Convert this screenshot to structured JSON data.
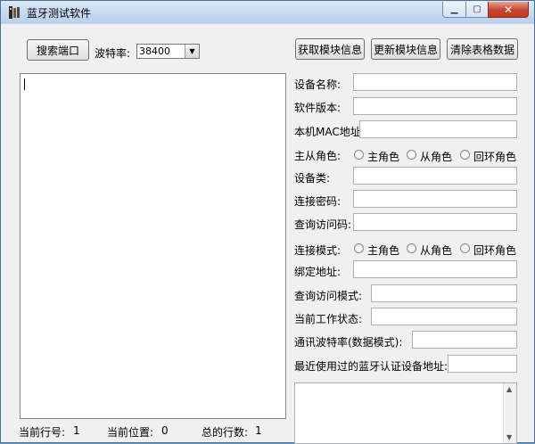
{
  "window": {
    "title": "蓝牙测试软件"
  },
  "toolbar": {
    "search_port": "搜索端口",
    "baud_label": "波特率:",
    "baud_value": "38400",
    "get_info": "获取模块信息",
    "update_info": "更新模块信息",
    "clear_table": "清除表格数据"
  },
  "form": {
    "device_name": "设备名称:",
    "software_version": "软件版本:",
    "local_mac": "本机MAC地址:",
    "role": "主从角色:",
    "device_class": "设备类:",
    "pin": "连接密码:",
    "inquiry_code": "查询访问码:",
    "conn_mode": "连接模式:",
    "bind_addr": "绑定地址:",
    "inquiry_mode": "查询访问模式:",
    "work_state": "当前工作状态:",
    "baud_data_mode": "通讯波特率(数据模式):",
    "recent_device": "最近使用过的蓝牙认证设备地址:",
    "radio_master": "主角色",
    "radio_slave": "从角色",
    "radio_loopback": "回环角色"
  },
  "status": {
    "line_label": "当前行号:",
    "line_value": "1",
    "pos_label": "当前位置:",
    "pos_value": "0",
    "total_label": "总的行数:",
    "total_value": "1"
  }
}
